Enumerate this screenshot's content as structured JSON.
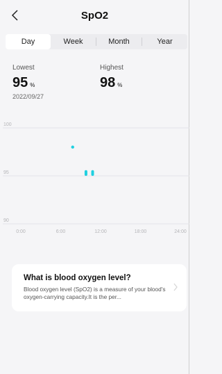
{
  "header": {
    "title": "SpO2",
    "back_icon": "chevron-left-icon"
  },
  "tabs": [
    {
      "label": "Day",
      "active": true
    },
    {
      "label": "Week",
      "active": false
    },
    {
      "label": "Month",
      "active": false
    },
    {
      "label": "Year",
      "active": false
    }
  ],
  "summary": {
    "lowest_label": "Lowest",
    "lowest_value": "95",
    "lowest_unit": "%",
    "highest_label": "Highest",
    "highest_value": "98",
    "highest_unit": "%",
    "date": "2022/09/27"
  },
  "chart_data": {
    "type": "scatter",
    "y_ticks": [
      "100",
      "95",
      "90"
    ],
    "x_ticks": [
      "0:00",
      "6:00",
      "12:00",
      "18:00",
      "24:00"
    ],
    "ylim": [
      90,
      100
    ],
    "xlim": [
      0,
      24
    ],
    "grid": true,
    "points": [
      {
        "x": 7.8,
        "y": 98,
        "shape": "dot"
      },
      {
        "x": 9.8,
        "y": 95.3,
        "shape": "bar",
        "low": 95,
        "high": 95.6
      },
      {
        "x": 10.8,
        "y": 95.3,
        "shape": "bar",
        "low": 95,
        "high": 95.6
      }
    ],
    "color": "#1fd0e0"
  },
  "info_card": {
    "title": "What is blood oxygen level?",
    "body": "Blood oxygen level (SpO2) is a measure of your blood's oxygen-carrying capacity.It is the per...",
    "chevron_icon": "chevron-right-icon"
  }
}
